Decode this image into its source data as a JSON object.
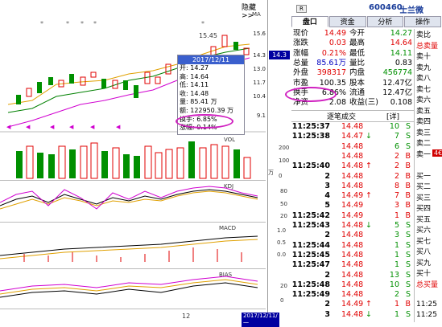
{
  "header": {
    "collapse_label": "隐藏>>",
    "r_badge": "R",
    "stock_code": "600460",
    "stock_name": "士兰微"
  },
  "tabs": [
    "盘口",
    "资金",
    "分析",
    "操作"
  ],
  "chart": {
    "candle_yaxis": [
      "15.6",
      "14.3",
      "13.0",
      "11.7",
      "10.4",
      "9.1"
    ],
    "last_price_marker": "14.3",
    "max_label": "15.45",
    "min_label": "9.1",
    "ma_label": "MA",
    "vol_label": "VOL",
    "vol_yaxis": [
      "200",
      "100",
      "0"
    ],
    "vol_unit": "万",
    "kdj_label": "KDJ",
    "kdj_yaxis": [
      "80",
      "50",
      "20"
    ],
    "macd_label": "MACD",
    "macd_yaxis": [
      "1.0",
      "0.5",
      "0.0"
    ],
    "bias_label": "BIAS",
    "bias_yaxis": [
      "20",
      "0"
    ],
    "x_month_label": "12",
    "x_date_label": "2017/12/11/一"
  },
  "tooltip": {
    "date": "2017/12/11",
    "lines": [
      "开: 14.27",
      "高: 14.64",
      "低: 14.11",
      "收: 14.48",
      "量: 85.41 万",
      "额: 122950.39 万",
      "换手: 6.85%",
      "涨幅: 0.14%"
    ]
  },
  "quote": {
    "rows": [
      {
        "l1": "现价",
        "v1": "14.49",
        "c1": "red",
        "l2": "今开",
        "v2": "14.27",
        "c2": "green"
      },
      {
        "l1": "涨跌",
        "v1": "0.03",
        "c1": "red",
        "l2": "最高",
        "v2": "14.64",
        "c2": "red"
      },
      {
        "l1": "涨幅",
        "v1": "0.21%",
        "c1": "red",
        "l2": "最低",
        "v2": "14.11",
        "c2": "green"
      },
      {
        "l1": "总量",
        "v1": "85.61万",
        "c1": "blue",
        "l2": "量比",
        "v2": "0.83",
        "c2": "black"
      },
      {
        "l1": "外盘",
        "v1": "398317",
        "c1": "red",
        "l2": "内盘",
        "v2": "456774",
        "c2": "green"
      },
      {
        "l1": "市盈",
        "v1": "100.35",
        "c1": "black",
        "l2": "股本",
        "v2": "12.47亿",
        "c2": "black"
      },
      {
        "l1": "换手",
        "v1": "6.86%",
        "c1": "black",
        "l2": "流通",
        "v2": "12.47亿",
        "c2": "black"
      },
      {
        "l1": "净资",
        "v1": "2.08",
        "c1": "black",
        "l2": "收益(三)",
        "v2": "0.108",
        "c2": "black"
      }
    ],
    "detail_title": "逐笔成交",
    "detail_btn": "[详]"
  },
  "ticks": [
    {
      "time": "11:25:37",
      "price": "14.48",
      "vol": "10",
      "dir": "S",
      "arrow": ""
    },
    {
      "time": "11:25:38",
      "price": "14.47",
      "vol": "7",
      "dir": "S",
      "arrow": "down"
    },
    {
      "time": "",
      "price": "14.48",
      "vol": "6",
      "dir": "S",
      "arrow": ""
    },
    {
      "time": "",
      "price": "14.48",
      "vol": "2",
      "dir": "B",
      "arrow": ""
    },
    {
      "time": "11:25:40",
      "price": "14.48",
      "vol": "2",
      "dir": "B",
      "arrow": "up"
    },
    {
      "time": "2",
      "price": "14.48",
      "vol": "2",
      "dir": "B",
      "arrow": ""
    },
    {
      "time": "3",
      "price": "14.48",
      "vol": "8",
      "dir": "B",
      "arrow": ""
    },
    {
      "time": "4",
      "price": "14.49",
      "vol": "7",
      "dir": "B",
      "arrow": "up"
    },
    {
      "time": "5",
      "price": "14.49",
      "vol": "3",
      "dir": "B",
      "arrow": ""
    },
    {
      "time": "11:25:42",
      "price": "14.49",
      "vol": "1",
      "dir": "B",
      "arrow": ""
    },
    {
      "time": "11:25:43",
      "price": "14.48",
      "vol": "5",
      "dir": "S",
      "arrow": "down"
    },
    {
      "time": "2",
      "price": "14.48",
      "vol": "3",
      "dir": "S",
      "arrow": ""
    },
    {
      "time": "11:25:44",
      "price": "14.48",
      "vol": "1",
      "dir": "S",
      "arrow": ""
    },
    {
      "time": "11:25:45",
      "price": "14.48",
      "vol": "1",
      "dir": "S",
      "arrow": ""
    },
    {
      "time": "11:25:47",
      "price": "14.48",
      "vol": "1",
      "dir": "S",
      "arrow": ""
    },
    {
      "time": "2",
      "price": "14.48",
      "vol": "13",
      "dir": "S",
      "arrow": ""
    },
    {
      "time": "11:25:48",
      "price": "14.48",
      "vol": "10",
      "dir": "S",
      "arrow": ""
    },
    {
      "time": "11:25:49",
      "price": "14.48",
      "vol": "2",
      "dir": "S",
      "arrow": ""
    },
    {
      "time": "2",
      "price": "14.49",
      "vol": "1",
      "dir": "B",
      "arrow": "up"
    },
    {
      "time": "3",
      "price": "14.48",
      "vol": "1",
      "dir": "S",
      "arrow": "down"
    }
  ],
  "side": {
    "labels": [
      "卖比",
      "总卖量",
      "卖十",
      "卖九",
      "卖八",
      "卖七",
      "卖六",
      "卖五",
      "卖四",
      "卖三",
      "卖二",
      "卖一",
      "",
      "买一",
      "买二",
      "买三",
      "买四",
      "买五",
      "买六",
      "买七",
      "买八",
      "买九",
      "买十",
      "总买量",
      "",
      "11:25",
      "11:25"
    ],
    "price_marker": "4€"
  }
}
